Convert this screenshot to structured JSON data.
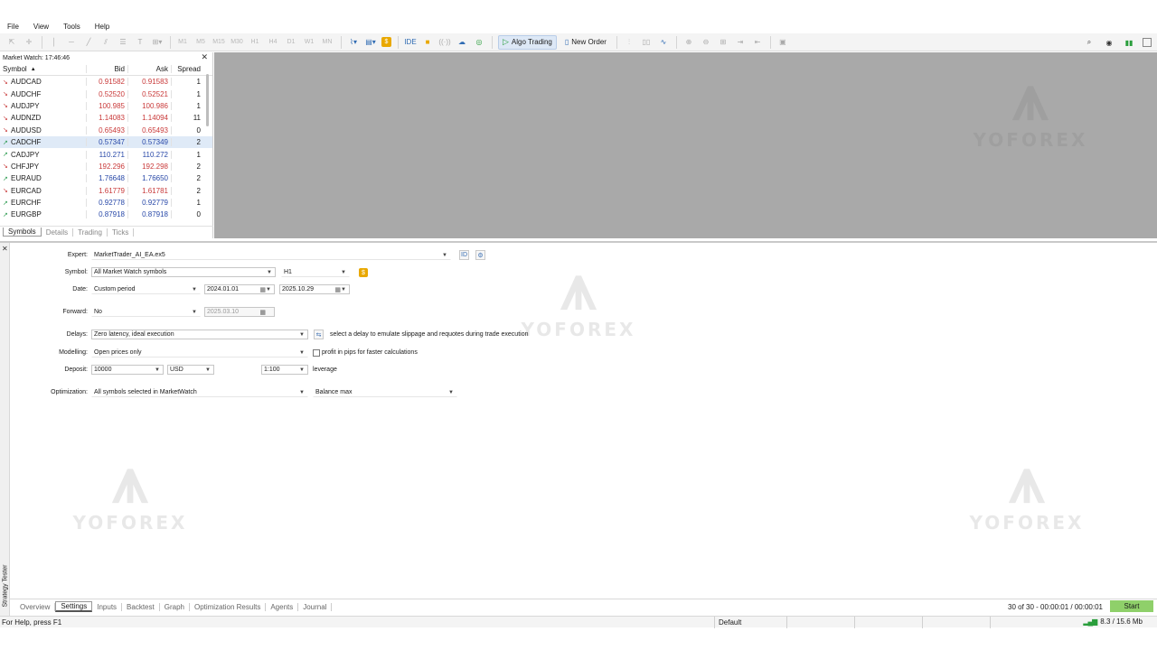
{
  "menu": {
    "items": [
      "File",
      "View",
      "Tools",
      "Help"
    ]
  },
  "toolbar": {
    "timeframes": [
      "M1",
      "M5",
      "M15",
      "M30",
      "H1",
      "H4",
      "D1",
      "W1",
      "MN"
    ],
    "ide_label": "IDE",
    "algo_trading_label": "Algo Trading",
    "new_order_label": "New Order"
  },
  "market_watch": {
    "title": "Market Watch: 17:46:46",
    "columns": {
      "symbol": "Symbol",
      "bid": "Bid",
      "ask": "Ask",
      "spread": "Spread"
    },
    "rows": [
      {
        "symbol": "AUDCAD",
        "bid": "0.91582",
        "ask": "0.91583",
        "spread": "1",
        "dir": "down"
      },
      {
        "symbol": "AUDCHF",
        "bid": "0.52520",
        "ask": "0.52521",
        "spread": "1",
        "dir": "down"
      },
      {
        "symbol": "AUDJPY",
        "bid": "100.985",
        "ask": "100.986",
        "spread": "1",
        "dir": "down"
      },
      {
        "symbol": "AUDNZD",
        "bid": "1.14083",
        "ask": "1.14094",
        "spread": "11",
        "dir": "down"
      },
      {
        "symbol": "AUDUSD",
        "bid": "0.65493",
        "ask": "0.65493",
        "spread": "0",
        "dir": "down"
      },
      {
        "symbol": "CADCHF",
        "bid": "0.57347",
        "ask": "0.57349",
        "spread": "2",
        "dir": "up",
        "selected": true
      },
      {
        "symbol": "CADJPY",
        "bid": "110.271",
        "ask": "110.272",
        "spread": "1",
        "dir": "up"
      },
      {
        "symbol": "CHFJPY",
        "bid": "192.296",
        "ask": "192.298",
        "spread": "2",
        "dir": "down"
      },
      {
        "symbol": "EURAUD",
        "bid": "1.76648",
        "ask": "1.76650",
        "spread": "2",
        "dir": "up"
      },
      {
        "symbol": "EURCAD",
        "bid": "1.61779",
        "ask": "1.61781",
        "spread": "2",
        "dir": "down"
      },
      {
        "symbol": "EURCHF",
        "bid": "0.92778",
        "ask": "0.92779",
        "spread": "1",
        "dir": "up"
      },
      {
        "symbol": "EURGBP",
        "bid": "0.87918",
        "ask": "0.87918",
        "spread": "0",
        "dir": "up"
      }
    ],
    "tabs": [
      "Symbols",
      "Details",
      "Trading",
      "Ticks"
    ]
  },
  "tester": {
    "vertical_title": "Strategy Tester",
    "expert": {
      "label": "Expert:",
      "value": "MarketTrader_AI_EA.ex5"
    },
    "symbol": {
      "label": "Symbol:",
      "value": "All Market Watch symbols",
      "timeframe": "H1"
    },
    "date": {
      "label": "Date:",
      "value": "Custom period",
      "from": "2024.01.01",
      "to": "2025.10.29"
    },
    "forward": {
      "label": "Forward:",
      "value": "No",
      "date": "2025.03.10"
    },
    "delays": {
      "label": "Delays:",
      "value": "Zero latency, ideal execution",
      "hint": "select a delay to emulate slippage and requotes during trade execution"
    },
    "modelling": {
      "label": "Modelling:",
      "value": "Open prices only",
      "checkbox_label": "profit in pips for faster calculations"
    },
    "deposit": {
      "label": "Deposit:",
      "value": "10000",
      "currency": "USD",
      "leverage": "1:100",
      "leverage_label": "leverage"
    },
    "optimization": {
      "label": "Optimization:",
      "value": "All symbols selected in MarketWatch",
      "criterion": "Balance max"
    },
    "tabs": [
      "Overview",
      "Settings",
      "Inputs",
      "Backtest",
      "Graph",
      "Optimization Results",
      "Agents",
      "Journal"
    ],
    "progress_text": "30 of 30  -  00:00:01 / 00:00:01",
    "start_label": "Start"
  },
  "status_bar": {
    "help": "For Help, press F1",
    "profile": "Default",
    "traffic": "8.3 / 15.6 Mb"
  },
  "watermark": {
    "word": "YOFOREX"
  },
  "colors": {
    "price_down": "#c93a3a",
    "price_up": "#2848a8",
    "start_button": "#8fd06a",
    "chart_area": "#a9a9a9"
  }
}
